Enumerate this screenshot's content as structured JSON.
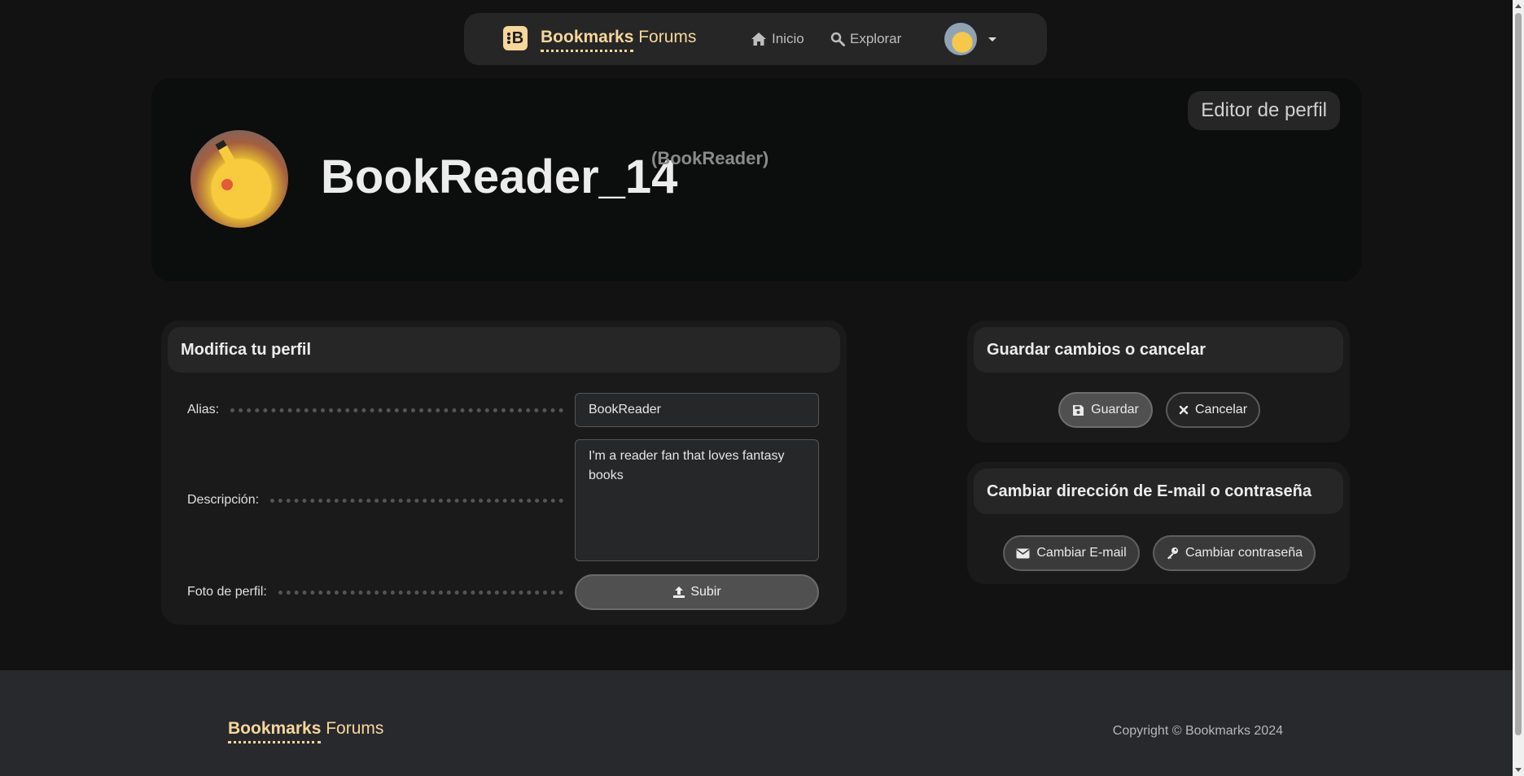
{
  "navbar": {
    "brand_bold": "Bookmarks",
    "brand_light": "Forums",
    "links": [
      {
        "label": "Inicio",
        "icon": "home-icon"
      },
      {
        "label": "Explorar",
        "icon": "search-icon"
      }
    ]
  },
  "profile": {
    "editor_badge": "Editor de perfil",
    "username": "BookReader_14",
    "alias_display": "(BookReader)"
  },
  "edit_form": {
    "title": "Modifica tu perfil",
    "alias_label": "Alias:",
    "alias_value": "BookReader",
    "description_label": "Descripción:",
    "description_value": "I'm a reader fan that loves fantasy books",
    "photo_label": "Foto de perfil:",
    "upload_label": "Subir"
  },
  "save_card": {
    "title": "Guardar cambios o cancelar",
    "save_label": "Guardar",
    "cancel_label": "Cancelar"
  },
  "account_card": {
    "title": "Cambiar dirección de E-mail o contraseña",
    "email_label": "Cambiar E-mail",
    "password_label": "Cambiar contraseña"
  },
  "footer": {
    "brand_bold": "Bookmarks",
    "brand_light": "Forums",
    "copyright": "Copyright © Bookmarks 2024"
  },
  "colors": {
    "accent": "#f7d69a",
    "background": "#121212",
    "card": "#1a1a1a"
  }
}
